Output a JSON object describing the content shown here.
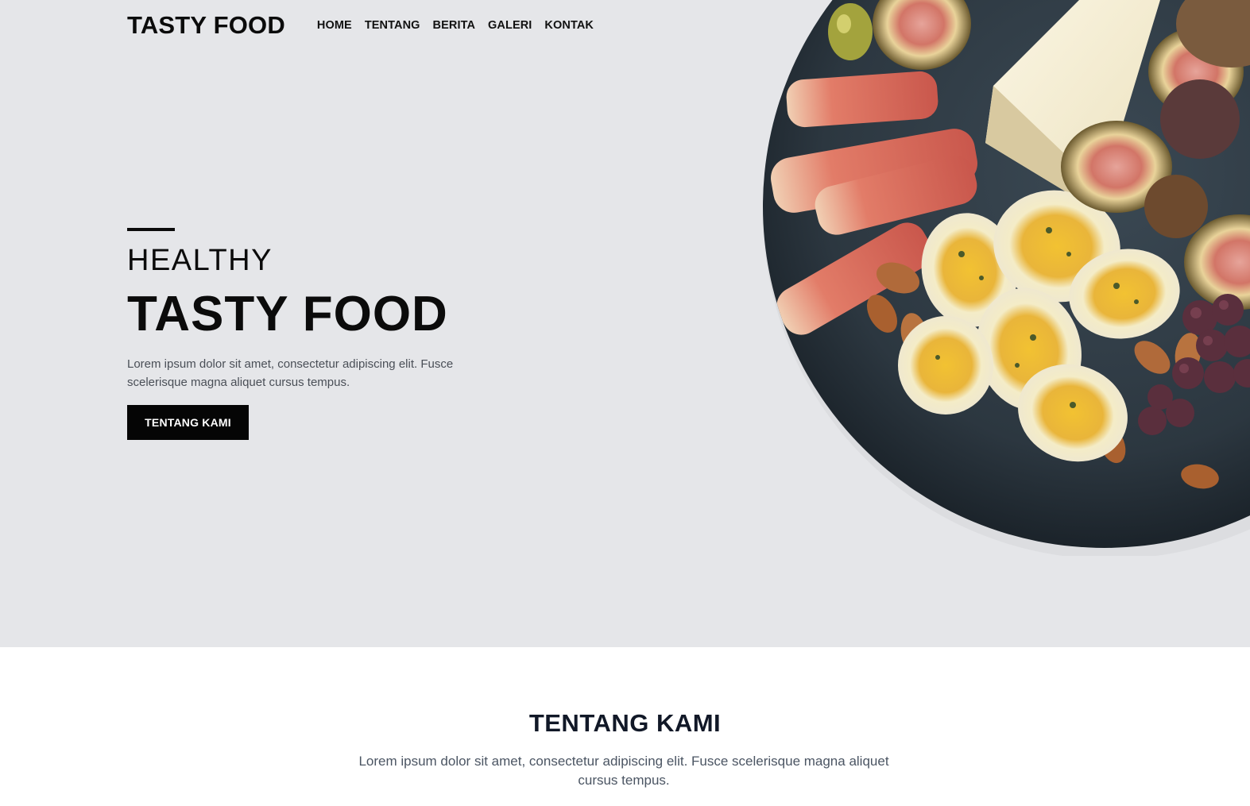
{
  "nav": {
    "brand": "TASTY FOOD",
    "links": [
      "HOME",
      "TENTANG",
      "BERITA",
      "GALERI",
      "KONTAK"
    ]
  },
  "hero": {
    "eyebrow": "HEALTHY",
    "title": "TASTY FOOD",
    "description": "Lorem ipsum dolor sit amet, consectetur adipiscing elit. Fusce scelerisque magna aliquet cursus tempus.",
    "button_label": "TENTANG KAMI",
    "image": "food-plate-illustration"
  },
  "about": {
    "title": "TENTANG KAMI",
    "description": "Lorem ipsum dolor sit amet, consectetur adipiscing elit. Fusce scelerisque magna aliquet cursus tempus."
  },
  "colors": {
    "hero_bg": "#e5e6e9",
    "button_bg": "#050505",
    "text_dark": "#0b0b0b",
    "text_muted": "#4a4f57"
  }
}
